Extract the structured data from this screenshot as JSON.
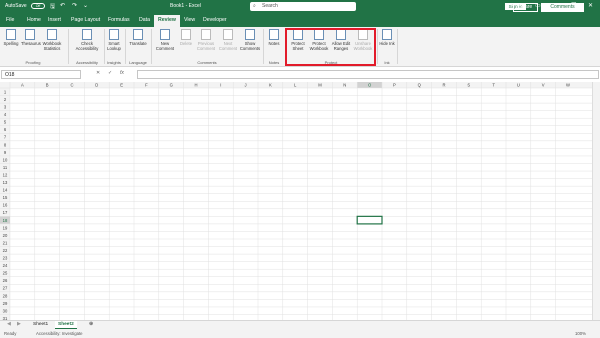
{
  "titlebar": {
    "autosave": "AutoSave",
    "toggle": "Off",
    "title": "Book1 - Excel",
    "search": "Search",
    "signin": "Sign in"
  },
  "tabs": [
    "File",
    "Home",
    "Insert",
    "Page Layout",
    "Formulas",
    "Data",
    "Review",
    "View",
    "Developer"
  ],
  "active_tab": "Review",
  "share": "Share",
  "comments": "Comments",
  "ribbon": {
    "spelling": "Spelling",
    "thesaurus": "Thesaurus",
    "workbook_stats": "Workbook Statistics",
    "check_accessibility": "Check Accessibility",
    "smart_lookup": "Smart Lookup",
    "translate": "Translate",
    "new_comment": "New Comment",
    "delete": "Delete",
    "previous_comment": "Previous Comment",
    "next_comment": "Next Comment",
    "show_comments": "Show Comments",
    "notes": "Notes",
    "protect_sheet": "Protect Sheet",
    "protect_workbook": "Protect Workbook",
    "allow_edit_ranges": "Allow Edit Ranges",
    "unshare_workbook": "Unshare Workbook",
    "hide_ink": "Hide Ink",
    "groups": {
      "proofing": "Proofing",
      "accessibility": "Accessibility",
      "insights": "Insights",
      "language": "Language",
      "comments": "Comments",
      "notes": "Notes",
      "protect": "Protect",
      "ink": "Ink"
    }
  },
  "formula_bar": {
    "name_box": "O18",
    "fx": "fx"
  },
  "grid": {
    "columns": [
      "A",
      "B",
      "C",
      "D",
      "E",
      "F",
      "G",
      "H",
      "I",
      "J",
      "K",
      "L",
      "M",
      "N",
      "O",
      "P",
      "Q",
      "R",
      "S",
      "T",
      "U",
      "V",
      "W"
    ],
    "rows": [
      "1",
      "2",
      "3",
      "4",
      "5",
      "6",
      "7",
      "8",
      "9",
      "10",
      "11",
      "12",
      "13",
      "14",
      "15",
      "16",
      "17",
      "18",
      "19",
      "20",
      "21",
      "22",
      "23",
      "24",
      "25",
      "26",
      "27",
      "28",
      "29",
      "30",
      "31"
    ],
    "selected_column": "O",
    "selected_row": "18"
  },
  "sheets": [
    "Sheet1",
    "Sheet2"
  ],
  "active_sheet": "Sheet2",
  "status": {
    "ready": "Ready",
    "accessibility": "Accessibility: Investigate",
    "zoom": "100%"
  },
  "colors": {
    "brand": "#217346",
    "highlight": "#e21b2a"
  }
}
